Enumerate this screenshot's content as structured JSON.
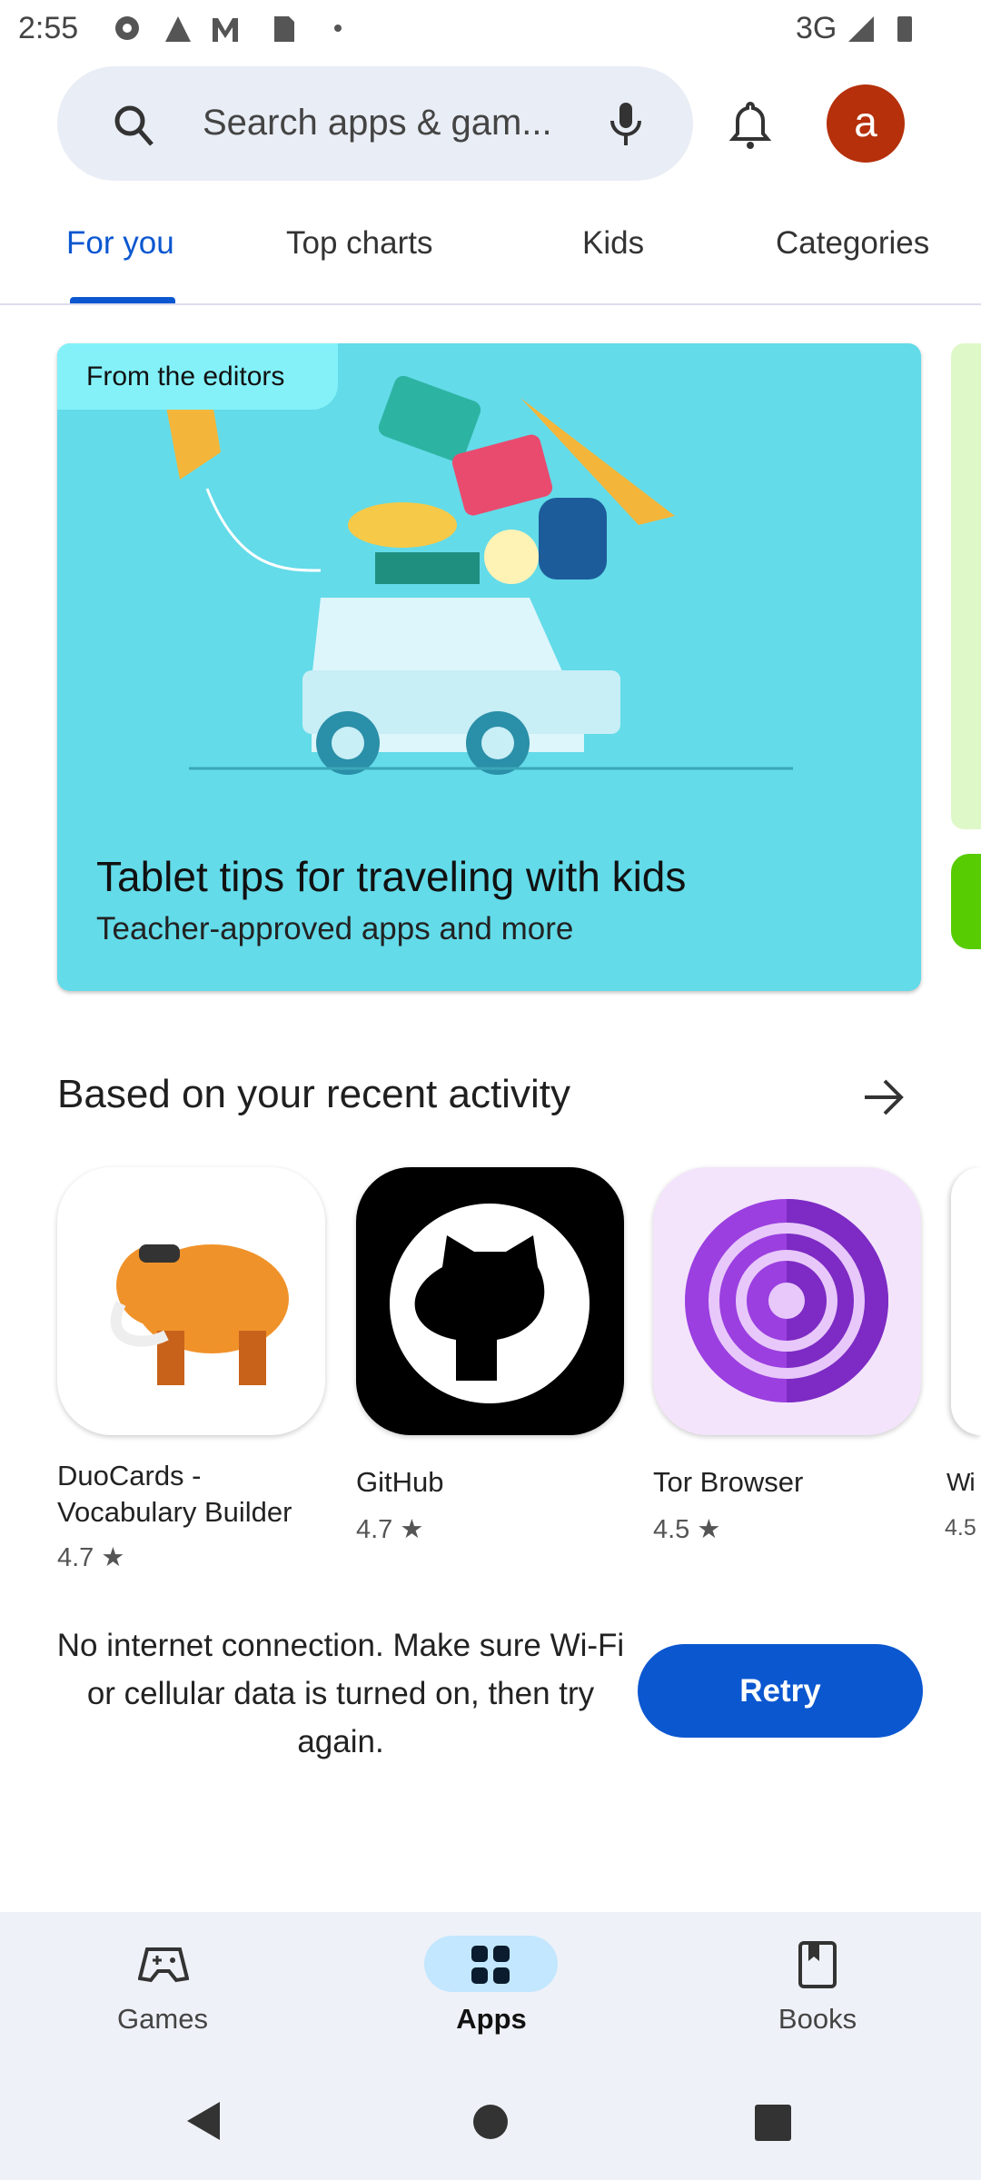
{
  "status_bar": {
    "time": "2:55",
    "network": "3G",
    "icons": [
      "gear-icon",
      "alert-icon",
      "gmail-icon",
      "sd-card-icon",
      "dot-icon",
      "signal-icon",
      "battery-icon"
    ]
  },
  "search": {
    "placeholder": "Search apps & gam...",
    "avatar_letter": "a",
    "avatar_color": "#b5300b"
  },
  "tabs": [
    {
      "label": "For you",
      "active": true
    },
    {
      "label": "Top charts"
    },
    {
      "label": "Kids"
    },
    {
      "label": "Categories"
    }
  ],
  "editors_card": {
    "label": "From the editors",
    "title": "Tablet tips for traveling with kids",
    "subtitle": "Teacher-approved apps and more"
  },
  "section": {
    "title": "Based on your recent activity"
  },
  "apps": [
    {
      "name": "DuoCards - Vocabulary Builder",
      "rating": "4.7"
    },
    {
      "name": "GitHub",
      "rating": "4.7"
    },
    {
      "name": "Tor Browser",
      "rating": "4.5"
    },
    {
      "name": "Wi",
      "rating": "4.5"
    }
  ],
  "error": {
    "message": "No internet connection. Make sure Wi-Fi or cellular data is turned on, then try again.",
    "retry_label": "Retry"
  },
  "bottom_nav": [
    {
      "label": "Games"
    },
    {
      "label": "Apps",
      "active": true
    },
    {
      "label": "Books"
    }
  ],
  "accent": "#0b57d0"
}
